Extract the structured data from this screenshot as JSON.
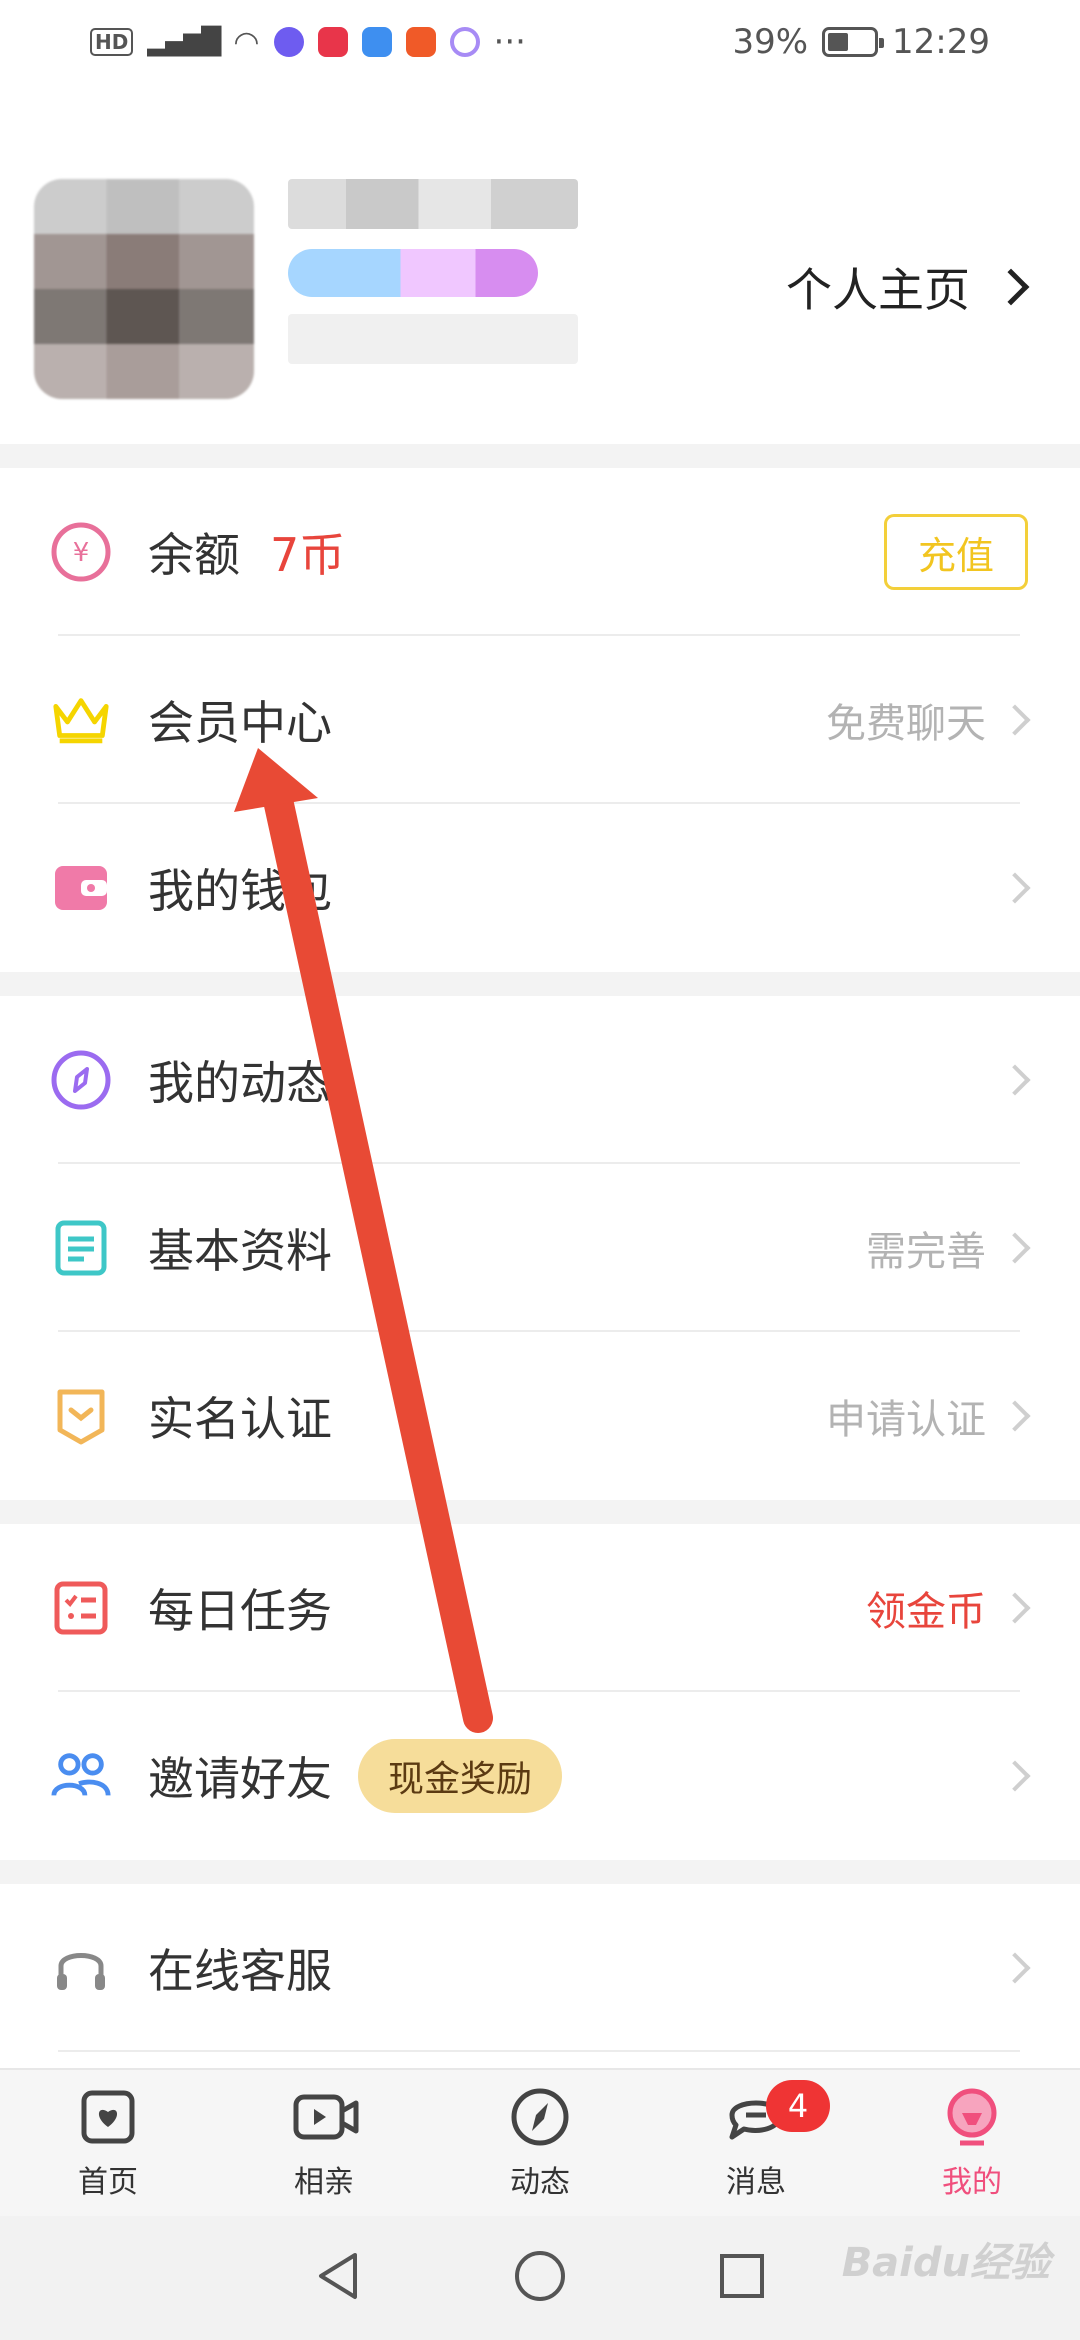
{
  "status_bar": {
    "hd": "HD",
    "signal": "4G",
    "battery": "39%",
    "time": "12:29",
    "more": "···"
  },
  "profile": {
    "home_link": "个人主页"
  },
  "balance": {
    "label": "余额",
    "value": "7币",
    "recharge": "充值"
  },
  "section1": [
    {
      "label": "会员中心",
      "right": "免费聊天"
    },
    {
      "label": "我的钱包",
      "right": ""
    }
  ],
  "section2": [
    {
      "label": "我的动态",
      "right": ""
    },
    {
      "label": "基本资料",
      "right": "需完善"
    },
    {
      "label": "实名认证",
      "right": "申请认证"
    }
  ],
  "section3": [
    {
      "label": "每日任务",
      "right": "领金币"
    },
    {
      "label": "邀请好友",
      "badge": "现金奖励"
    }
  ],
  "section4": [
    {
      "label": "在线客服"
    }
  ],
  "tabs": [
    {
      "label": "首页",
      "icon": "heart-card-icon"
    },
    {
      "label": "相亲",
      "icon": "video-icon"
    },
    {
      "label": "动态",
      "icon": "compass-icon"
    },
    {
      "label": "消息",
      "icon": "chat-icon",
      "badge": "4"
    },
    {
      "label": "我的",
      "icon": "profile-icon"
    }
  ],
  "watermark": "Baidu经验",
  "colors": {
    "accent": "#f04f7d",
    "red": "#e8453c",
    "gold": "#f3cf3a",
    "arrow": "#e84a35"
  }
}
